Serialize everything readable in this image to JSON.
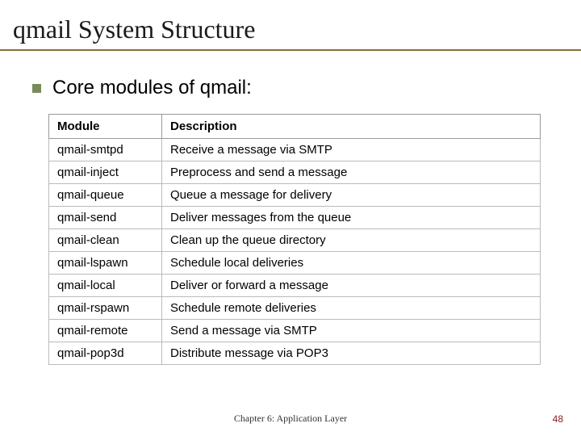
{
  "title": "qmail System Structure",
  "bullet": "Core modules of qmail:",
  "table": {
    "headers": {
      "module": "Module",
      "description": "Description"
    },
    "rows": [
      {
        "module": "qmail-smtpd",
        "description": "Receive a message via SMTP"
      },
      {
        "module": "qmail-inject",
        "description": "Preprocess and send a message"
      },
      {
        "module": "qmail-queue",
        "description": "Queue a message for delivery"
      },
      {
        "module": "qmail-send",
        "description": "Deliver messages from the queue"
      },
      {
        "module": "qmail-clean",
        "description": "Clean up the queue directory"
      },
      {
        "module": "qmail-lspawn",
        "description": "Schedule local deliveries"
      },
      {
        "module": "qmail-local",
        "description": "Deliver or forward a message"
      },
      {
        "module": "qmail-rspawn",
        "description": "Schedule remote deliveries"
      },
      {
        "module": "qmail-remote",
        "description": "Send a message via SMTP"
      },
      {
        "module": "qmail-pop3d",
        "description": "Distribute message via POP3"
      }
    ]
  },
  "footer": "Chapter 6: Application Layer",
  "page_number": "48"
}
